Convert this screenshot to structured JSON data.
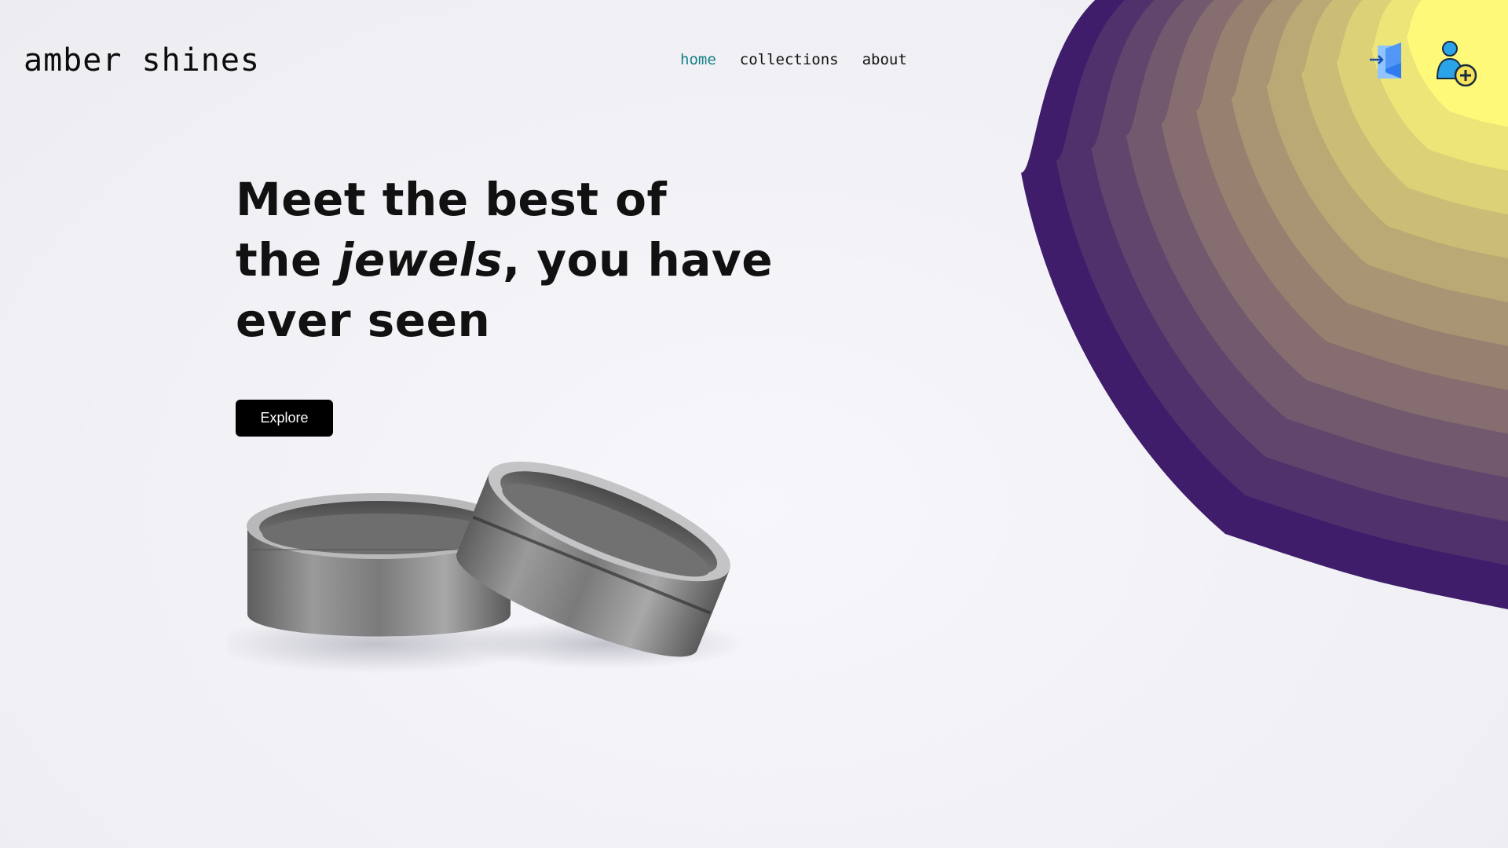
{
  "brand": {
    "name": "amber shines"
  },
  "nav": {
    "items": [
      {
        "label": "home",
        "active": true
      },
      {
        "label": "collections",
        "active": false
      },
      {
        "label": "about",
        "active": false
      }
    ]
  },
  "header_actions": {
    "login_icon": "login-door-icon",
    "signup_icon": "add-user-icon"
  },
  "hero": {
    "line1": "Meet the best of",
    "line2_prefix": "the ",
    "line2_emphasis": "jewels",
    "line2_suffix": ", you have",
    "line3": "ever seen",
    "cta_label": "Explore"
  },
  "colors": {
    "accent_nav_active": "#137f86",
    "button_bg": "#000000",
    "blob_outer": "#3f1d6a",
    "blob_inner": "#fff97a"
  },
  "image": {
    "subject": "two-silver-rings-icon"
  }
}
